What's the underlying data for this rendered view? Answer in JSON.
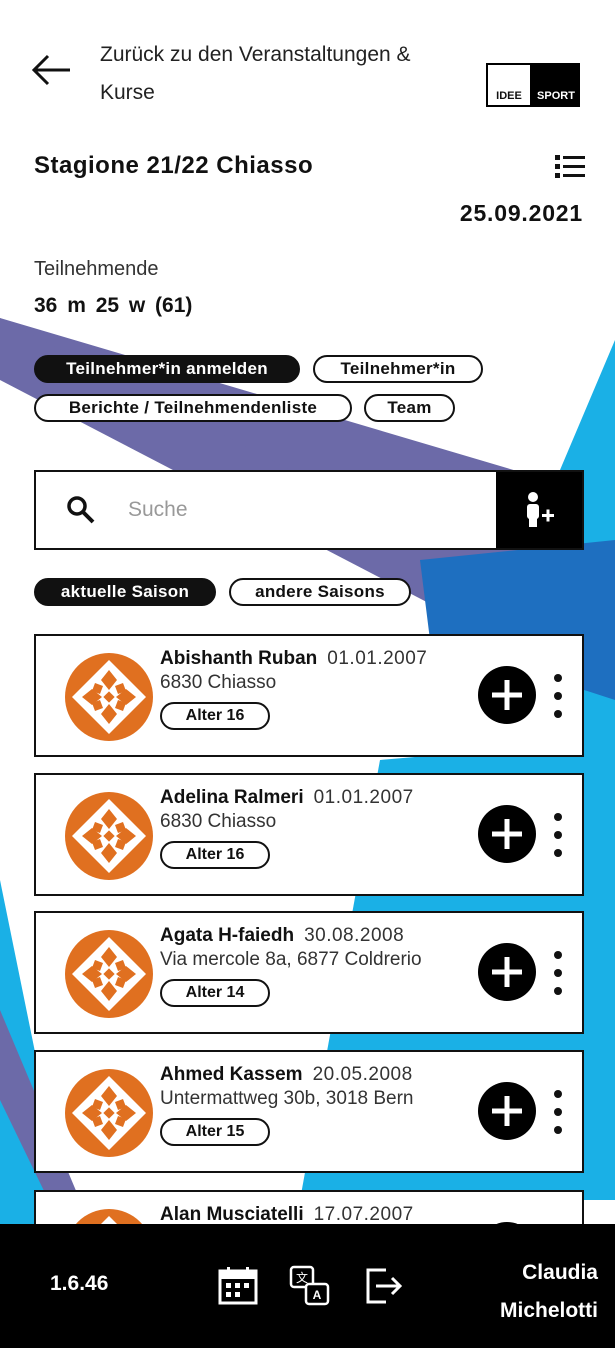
{
  "header": {
    "back_label": "Zurück zu den Veranstaltungen & Kurse",
    "logo_left": "IDEE",
    "logo_right": "SPORT",
    "title": "Stagione 21/22 Chiasso",
    "date": "25.09.2021"
  },
  "participants": {
    "label": "Teilnehmende",
    "counts": "36 m  25 w  (61)"
  },
  "actions": {
    "register": "Teilnehmer*in anmelden",
    "participant": "Teilnehmer*in",
    "reports": "Berichte / Teilnehmendenliste",
    "team": "Team"
  },
  "search": {
    "placeholder": "Suche"
  },
  "season_filter": {
    "current": "aktuelle Saison",
    "other": "andere Saisons"
  },
  "people": [
    {
      "name": "Abishanth Ruban",
      "dob": "01.01.2007",
      "address": "6830 Chiasso",
      "age": "Alter 16"
    },
    {
      "name": "Adelina Ralmeri",
      "dob": "01.01.2007",
      "address": "6830 Chiasso",
      "age": "Alter 16"
    },
    {
      "name": "Agata H-faiedh",
      "dob": "30.08.2008",
      "address": "Via mercole 8a, 6877 Coldrerio",
      "age": "Alter 14"
    },
    {
      "name": "Ahmed Kassem",
      "dob": "20.05.2008",
      "address": "Untermattweg 30b, 3018 Bern",
      "age": "Alter 15"
    },
    {
      "name": "Alan Musciatelli",
      "dob": "17.07.2007",
      "address": "",
      "age": ""
    }
  ],
  "footer": {
    "version": "1.6.46",
    "user_first": "Claudia",
    "user_last": "Michelotti",
    "icons": [
      "calendar-icon",
      "translate-icon",
      "logout-icon"
    ]
  },
  "colors": {
    "accent_orange": "#e07020",
    "band_purple": "#6c6aa8",
    "band_blue": "#1ab0e6",
    "band_dark_blue": "#1e6fc0"
  }
}
